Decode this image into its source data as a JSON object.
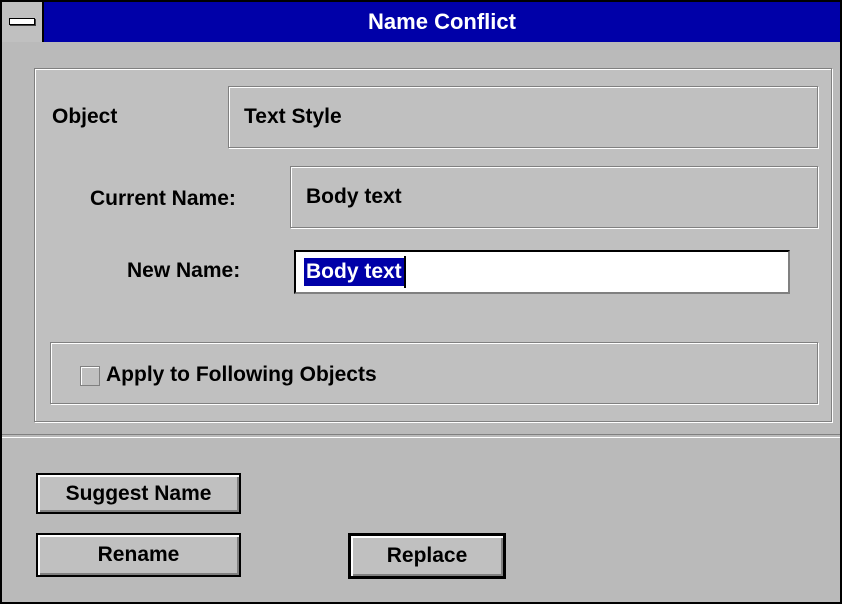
{
  "window": {
    "title": "Name Conflict"
  },
  "object": {
    "label": "Object",
    "value": "Text Style"
  },
  "current_name": {
    "label": "Current Name:",
    "value": "Body text"
  },
  "new_name": {
    "label": "New Name:",
    "value": "Body text"
  },
  "apply_checkbox": {
    "label": "Apply to Following Objects",
    "checked": false
  },
  "buttons": {
    "suggest": "Suggest Name",
    "rename": "Rename",
    "replace": "Replace"
  },
  "colors": {
    "title_bar": "#0000a8",
    "face": "#c0c0c0",
    "selection": "#0000a8"
  },
  "icons": {
    "system_menu": "system-menu-icon"
  }
}
